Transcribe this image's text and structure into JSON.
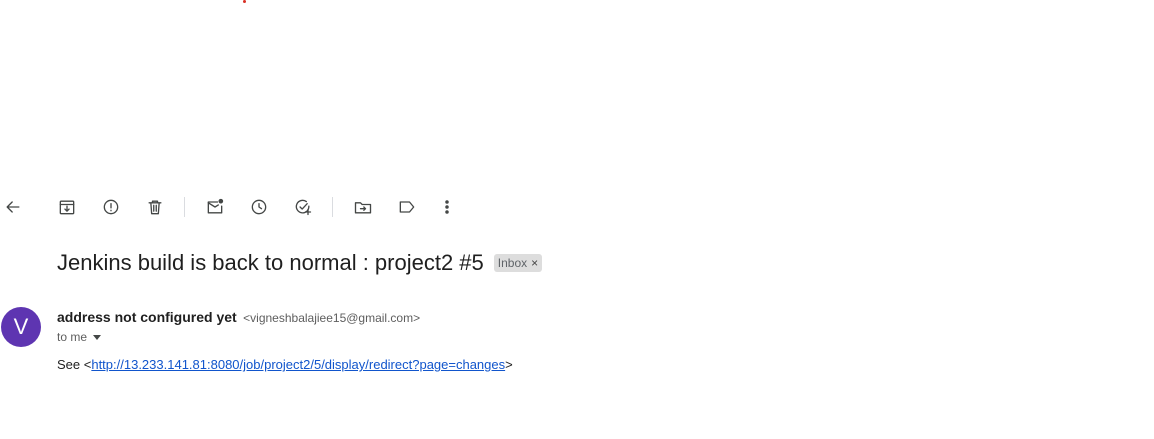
{
  "toolbar": {
    "icons": [
      "back-arrow-icon",
      "archive-icon",
      "report-spam-icon",
      "delete-icon",
      "mark-unread-icon",
      "snooze-icon",
      "add-task-icon",
      "move-to-icon",
      "label-icon",
      "more-vert-icon"
    ]
  },
  "email": {
    "subject": "Jenkins build is back to normal : project2 #5",
    "label": "Inbox",
    "label_remove": "×",
    "avatar_letter": "V",
    "avatar_color": "#5e35b1",
    "sender_name": "address not configured yet",
    "sender_email": "<vigneshbalajiee15@gmail.com>",
    "to_text": "to me",
    "body_prefix": "See <",
    "body_link": "http://13.233.141.81:8080/job/project2/5/display/redirect?page=changes",
    "body_suffix": ">"
  }
}
